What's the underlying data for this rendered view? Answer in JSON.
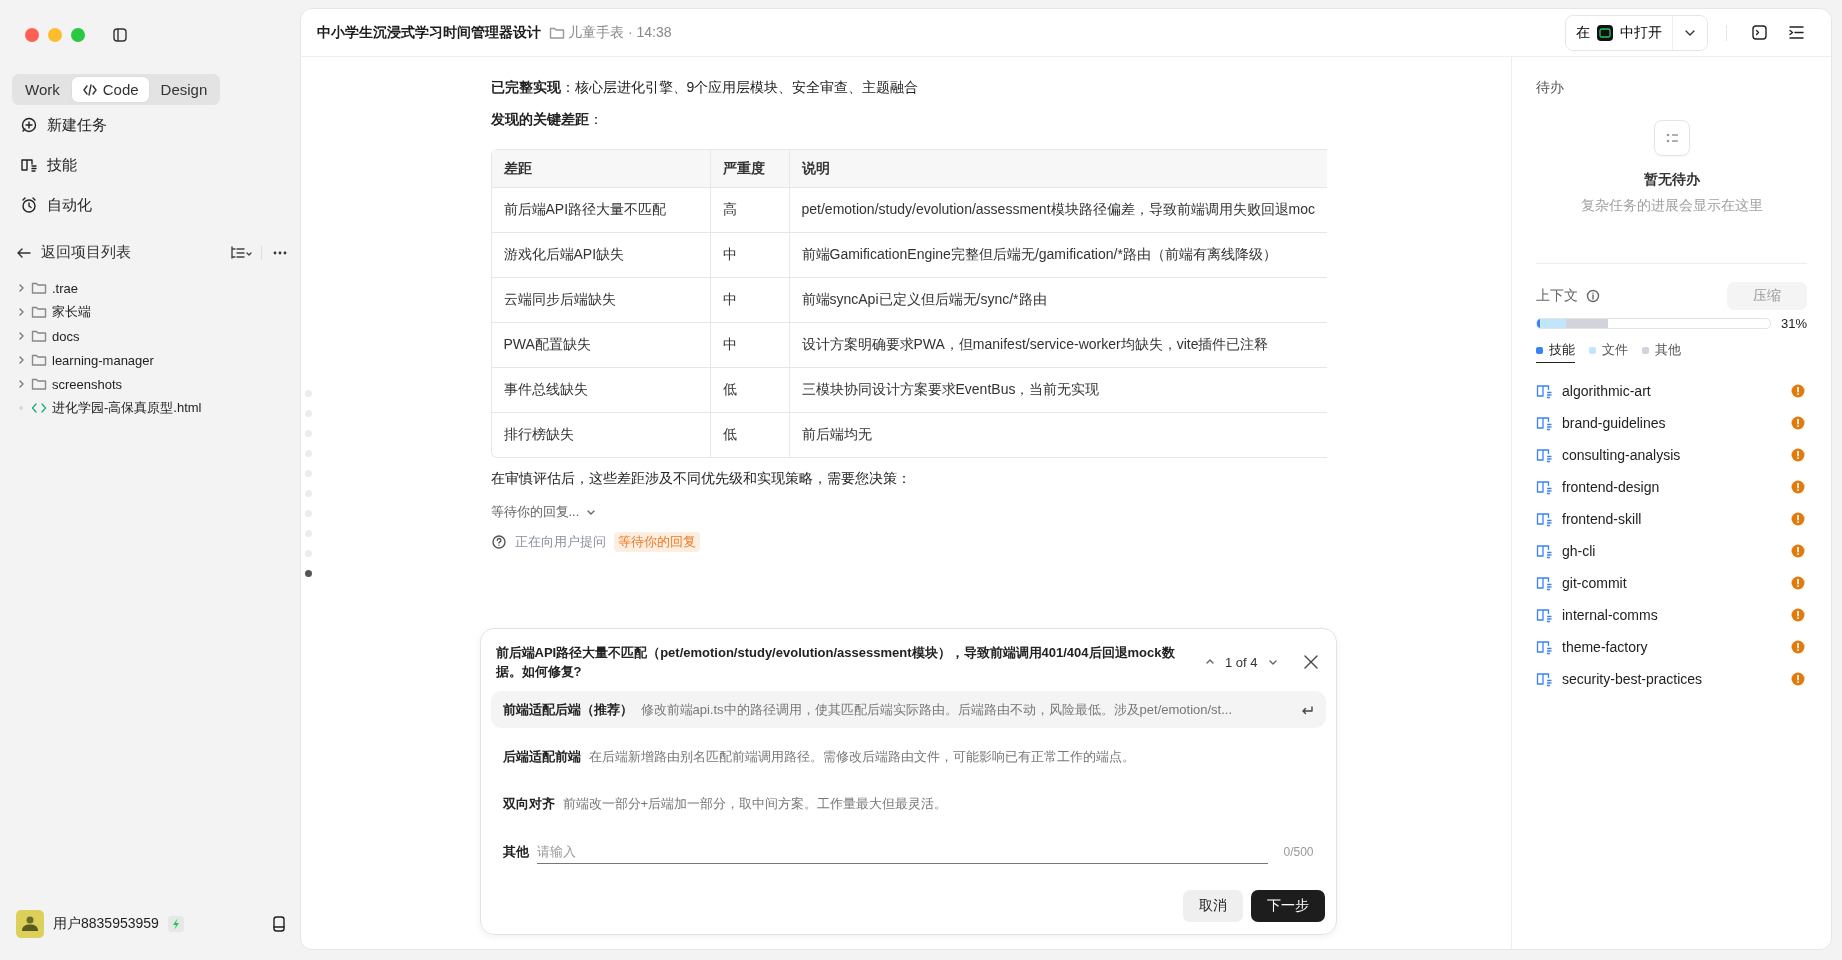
{
  "sidebar": {
    "modes": [
      {
        "label": "Work",
        "kind": "plain",
        "selected": false
      },
      {
        "label": "Code",
        "kind": "code",
        "selected": true
      },
      {
        "label": "Design",
        "kind": "plain",
        "selected": false
      }
    ],
    "nav": [
      {
        "label": "新建任务",
        "kind": "new"
      },
      {
        "label": "技能",
        "kind": "skills"
      },
      {
        "label": "自动化",
        "kind": "automation"
      }
    ],
    "back": "返回项目列表",
    "tree": [
      {
        "name": ".trae",
        "kind": "folder"
      },
      {
        "name": "家长端",
        "kind": "folder"
      },
      {
        "name": "docs",
        "kind": "folder"
      },
      {
        "name": "learning-manager",
        "kind": "folder"
      },
      {
        "name": "screenshots",
        "kind": "folder"
      },
      {
        "name": "进化学园-高保真原型.html",
        "kind": "file"
      }
    ],
    "user": {
      "name": "用户8835953959"
    }
  },
  "header": {
    "title": "中小学生沉浸式学习时间管理器设计",
    "folder": "儿童手表 · 14:38",
    "open_before": "在",
    "open_after": "中打开"
  },
  "message_nav": [
    {
      "selected": false
    },
    {
      "selected": false
    },
    {
      "selected": false
    },
    {
      "selected": false
    },
    {
      "selected": false
    },
    {
      "selected": false
    },
    {
      "selected": false
    },
    {
      "selected": false
    },
    {
      "selected": false
    },
    {
      "selected": true
    }
  ],
  "content": {
    "summary": "**已完整实现**：核心层进化引擎、9个应用层模块、安全审查、主题融合",
    "heading": "**发现的关键差距**：",
    "table": {
      "columns": [
        "差距",
        "严重度",
        "说明"
      ],
      "rows": [
        [
          "前后端API路径大量不匹配",
          "高",
          "pet/emotion/study/evolution/assessment模块路径偏差，导致前端调用失败回退moc"
        ],
        [
          "游戏化后端API缺失",
          "中",
          "前端GamificationEngine完整但后端无/gamification/*路由（前端有离线降级）"
        ],
        [
          "云端同步后端缺失",
          "中",
          "前端syncApi已定义但后端无/sync/*路由"
        ],
        [
          "PWA配置缺失",
          "中",
          "设计方案明确要求PWA，但manifest/service-worker均缺失，vite插件已注释"
        ],
        [
          "事件总线缺失",
          "低",
          "三模块协同设计方案要求EventBus，当前无实现"
        ],
        [
          "排行榜缺失",
          "低",
          "前后端均无"
        ]
      ]
    },
    "conclusion": "在审慎评估后，这些差距涉及不同优先级和实现策略，需要您决策：",
    "waiting": "等待你的回复...",
    "status": {
      "text": "正在向用户提问",
      "badge": "等待你的回复"
    }
  },
  "question": {
    "title": "前后端API路径大量不匹配（pet/emotion/study/evolution/assessment模块），导致前端调用401/404后回退mock数据。如何修复?",
    "pager": "1 of 4",
    "options": [
      {
        "label": "前端适配后端（推荐）",
        "description": "修改前端api.ts中的路径调用，使其匹配后端实际路由。后端路由不动，风险最低。涉及pet/emotion/st...",
        "selected": true
      },
      {
        "label": "后端适配前端",
        "description": "在后端新增路由别名匹配前端调用路径。需修改后端路由文件，可能影响已有正常工作的端点。",
        "selected": false
      },
      {
        "label": "双向对齐",
        "description": "前端改一部分+后端加一部分，取中间方案。工作量最大但最灵活。",
        "selected": false
      }
    ],
    "other": {
      "label": "其他",
      "placeholder": "请输入",
      "counter": "0/500"
    },
    "buttons": [
      {
        "label": "取消",
        "kind": "secondary"
      },
      {
        "label": "下一步",
        "kind": "primary"
      }
    ]
  },
  "todo": {
    "title": "待办",
    "empty_title": "暂无待办",
    "empty_hint": "复杂任务的进展会显示在这里"
  },
  "context": {
    "title": "上下文",
    "compress": "压缩",
    "percent": "31%",
    "segments": [
      {
        "color": "#3b82f6",
        "level": 0.015
      },
      {
        "color": "#bfe6fa",
        "level": 0.11
      },
      {
        "color": "#d1d5db",
        "level": 0.18
      }
    ],
    "tabs": [
      {
        "label": "技能",
        "color": "#3b82f6",
        "selected": true
      },
      {
        "label": "文件",
        "color": "#bfe6fa",
        "selected": false
      },
      {
        "label": "其他",
        "color": "#d1d5db",
        "selected": false
      }
    ],
    "skills": [
      "algorithmic-art",
      "brand-guidelines",
      "consulting-analysis",
      "frontend-design",
      "frontend-skill",
      "gh-cli",
      "git-commit",
      "internal-comms",
      "theme-factory",
      "security-best-practices"
    ]
  }
}
